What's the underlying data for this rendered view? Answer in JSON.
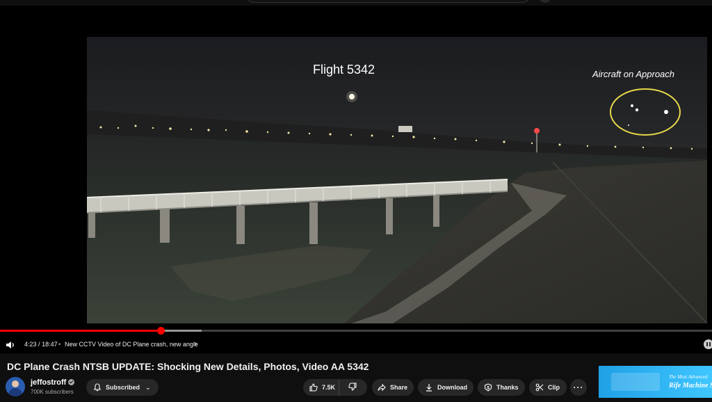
{
  "video": {
    "overlay_title": "Flight 5342",
    "overlay_label": "Aircraft on Approach",
    "progress": 0.226
  },
  "player": {
    "current_time": "4:23",
    "duration": "18:47",
    "time_sep": "/",
    "chapter_sep": "•",
    "chapter_title": "New CCTV Video of DC Plane crash, new angle"
  },
  "watch": {
    "title": "DC Plane Crash NTSB UPDATE: Shocking New Details, Photos, Video AA 5342",
    "channel_name": "jeffostroff",
    "subscribers": "700K subscribers",
    "subscribe_label": "Subscribed",
    "likes": "7.5K",
    "share_label": "Share",
    "download_label": "Download",
    "thanks_label": "Thanks",
    "clip_label": "Clip",
    "more_label": "···"
  },
  "ad": {
    "line1": "The Most Advanced",
    "line2": "Rife Machine Se"
  },
  "colors": {
    "background": "#0f0f0f",
    "progress_played": "#ff0000",
    "pill": "#272727",
    "overlay_circle": "#e8d84a"
  },
  "icons": [
    "volume-icon",
    "chevron-right-icon",
    "pause-icon",
    "verified-icon",
    "bell-icon",
    "chevron-down-icon",
    "thumbs-up-icon",
    "thumbs-down-icon",
    "share-icon",
    "download-icon",
    "thanks-icon",
    "scissors-icon",
    "more-icon"
  ]
}
